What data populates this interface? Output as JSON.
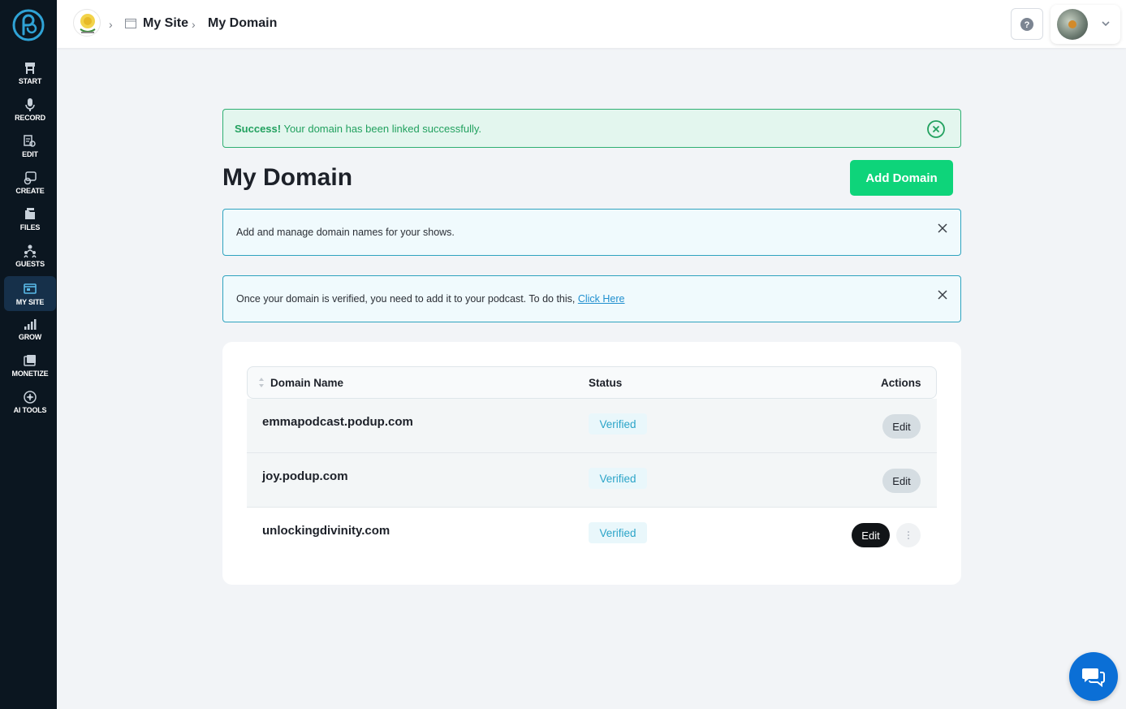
{
  "sidebar": {
    "items": [
      {
        "label": "START",
        "icon": "start-icon"
      },
      {
        "label": "RECORD",
        "icon": "microphone-icon"
      },
      {
        "label": "EDIT",
        "icon": "edit-icon"
      },
      {
        "label": "CREATE",
        "icon": "create-icon"
      },
      {
        "label": "FILES",
        "icon": "files-icon"
      },
      {
        "label": "GUESTS",
        "icon": "guests-icon"
      },
      {
        "label": "MY SITE",
        "icon": "my-site-icon",
        "active": true
      },
      {
        "label": "GROW",
        "icon": "grow-icon"
      },
      {
        "label": "MONETIZE",
        "icon": "monetize-icon"
      },
      {
        "label": "AI TOOLS",
        "icon": "ai-tools-icon"
      }
    ]
  },
  "breadcrumb": {
    "site": "My Site",
    "current": "My Domain"
  },
  "alert": {
    "strong": "Success!",
    "message": " Your domain has been linked successfully."
  },
  "page": {
    "title": "My Domain",
    "add_button": "Add Domain"
  },
  "info": {
    "manage": "Add and manage domain names for your shows.",
    "verify_prefix": "Once your domain is verified, you need to add it to your podcast. To do this, ",
    "verify_link": "Click Here"
  },
  "table": {
    "columns": [
      "Domain Name",
      "Status",
      "Actions"
    ],
    "rows": [
      {
        "domain": "emmapodcast.podup.com",
        "status": "Verified",
        "action": "Edit"
      },
      {
        "domain": "joy.podup.com",
        "status": "Verified",
        "action": "Edit"
      },
      {
        "domain": "unlockingdivinity.com",
        "status": "Verified",
        "action": "Edit"
      }
    ]
  },
  "colors": {
    "accent_green": "#0ed47a",
    "success_text": "#22a15f",
    "info_border": "#2fa3bf",
    "sidebar_bg": "#0b1620",
    "status_text": "#2ba4c8"
  }
}
